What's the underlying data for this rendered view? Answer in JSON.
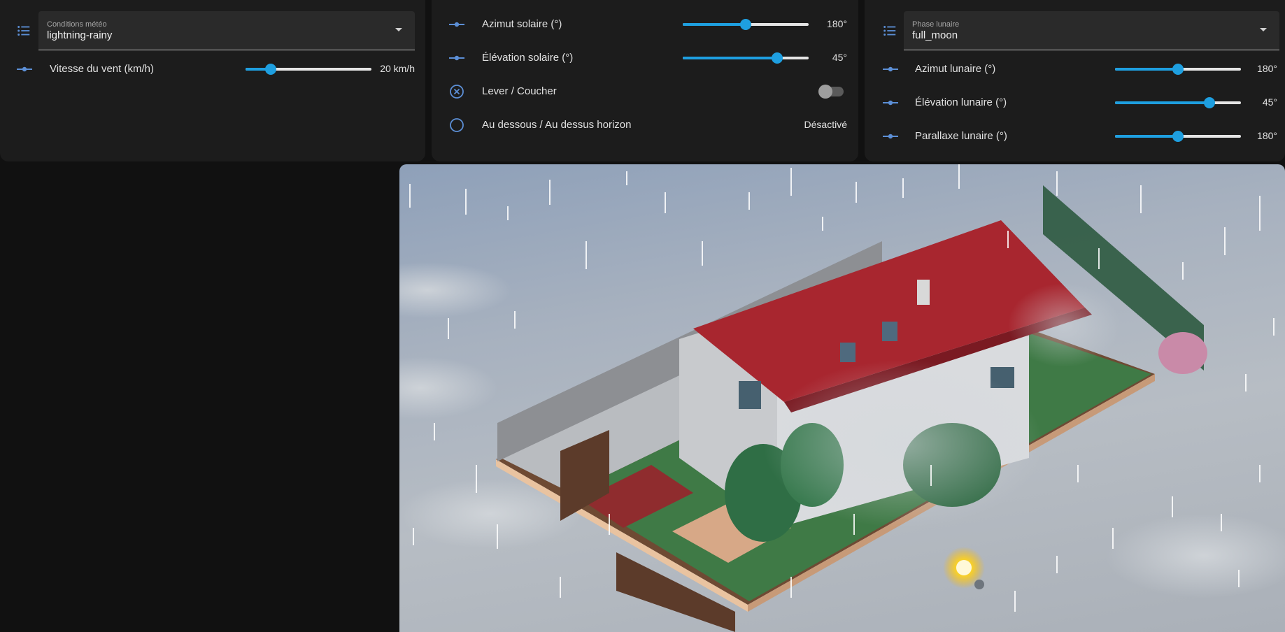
{
  "weather_card": {
    "select_label": "Conditions météo",
    "select_value": "lightning-rainy",
    "wind": {
      "label": "Vitesse du vent (km/h)",
      "value": "20 km/h",
      "fraction": 0.2
    }
  },
  "sun_card": {
    "azimuth": {
      "label": "Azimut solaire (°)",
      "value": "180°",
      "fraction": 0.5
    },
    "elevation": {
      "label": "Élévation solaire (°)",
      "value": "45°",
      "fraction": 0.75
    },
    "rise_set": {
      "label": "Lever / Coucher",
      "state": "off"
    },
    "horizon": {
      "label": "Au dessous / Au dessus horizon",
      "value": "Désactivé"
    }
  },
  "moon_card": {
    "select_label": "Phase lunaire",
    "select_value": "full_moon",
    "azimuth": {
      "label": "Azimut lunaire (°)",
      "value": "180°",
      "fraction": 0.5
    },
    "elevation": {
      "label": "Élévation lunaire (°)",
      "value": "45°",
      "fraction": 0.75
    },
    "parallax": {
      "label": "Parallaxe lunaire (°)",
      "value": "180°",
      "fraction": 0.5
    }
  },
  "colors": {
    "accent": "#1e9fe0",
    "card": "#1c1c1c",
    "background": "#111111",
    "roof": "#a8262f",
    "sun": "#ffe033"
  },
  "icons": {
    "select": "format-list-bulleted-icon",
    "slider": "ray-vertex-icon",
    "toggle": "close-circle-outline-icon",
    "binary": "circle-outline-icon"
  }
}
